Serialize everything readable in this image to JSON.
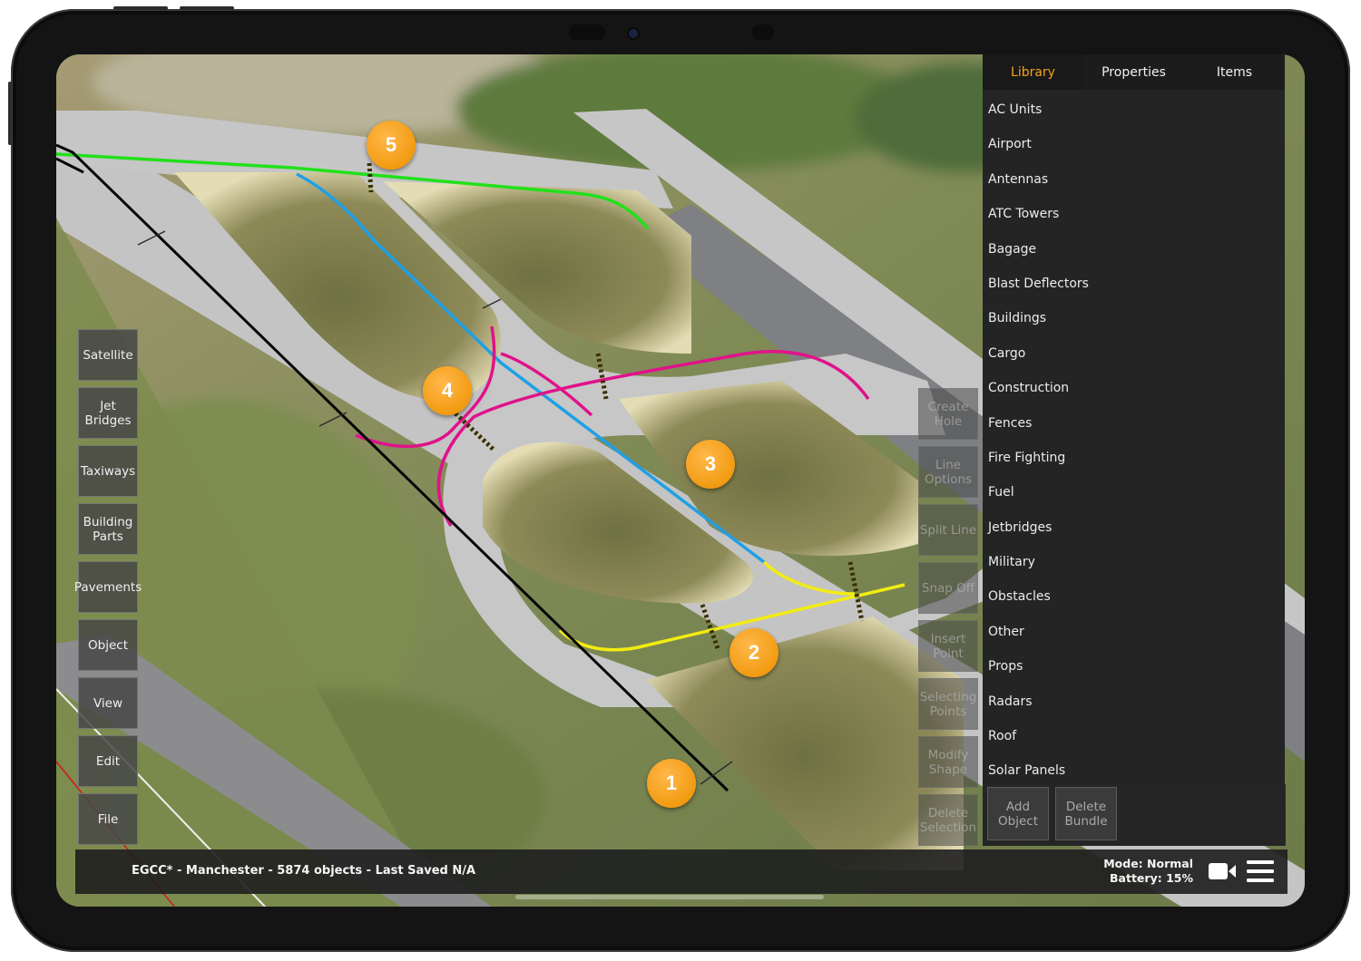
{
  "panel": {
    "tabs": [
      {
        "label": "Library",
        "active": true
      },
      {
        "label": "Properties",
        "active": false
      },
      {
        "label": "Items",
        "active": false
      }
    ],
    "library_items": [
      "AC Units",
      "Airport",
      "Antennas",
      "ATC Towers",
      "Bagage",
      "Blast Deflectors",
      "Buildings",
      "Cargo",
      "Construction",
      "Fences",
      "Fire Fighting",
      "Fuel",
      "Jetbridges",
      "Military",
      "Obstacles",
      "Other",
      "Props",
      "Radars",
      "Roof",
      "Solar Panels"
    ],
    "footer_buttons": {
      "add": "Add Object",
      "delete": "Delete Bundle"
    }
  },
  "left_toolbar": [
    "Satellite",
    "Jet Bridges",
    "Taxiways",
    "Building Parts",
    "Pavements",
    "Object",
    "View",
    "Edit",
    "File"
  ],
  "tool_buttons": {
    "create_hole": "Create Hole",
    "line_options": "Line Options",
    "split_line": "Split Line",
    "snap_off": "Snap Off",
    "insert_point": "Insert Point",
    "selecting_points": "Selecting Points",
    "modify_shape": "Modify Shape",
    "delete_selection": "Delete Selection"
  },
  "status_bar": {
    "info": "EGCC* - Manchester - 5874 objects - Last Saved N/A",
    "mode": "Mode: Normal",
    "battery": "Battery: 15%"
  },
  "markers": [
    "1",
    "2",
    "3",
    "4",
    "5"
  ],
  "icons": {
    "camera": "video-camera-icon",
    "menu": "hamburger-menu-icon"
  },
  "colors": {
    "accent": "#f4a015",
    "line_green": "#22e01a",
    "line_blue": "#1ea0e6",
    "line_magenta": "#e0128a",
    "line_yellow": "#f3ec12",
    "line_black": "#050505"
  }
}
